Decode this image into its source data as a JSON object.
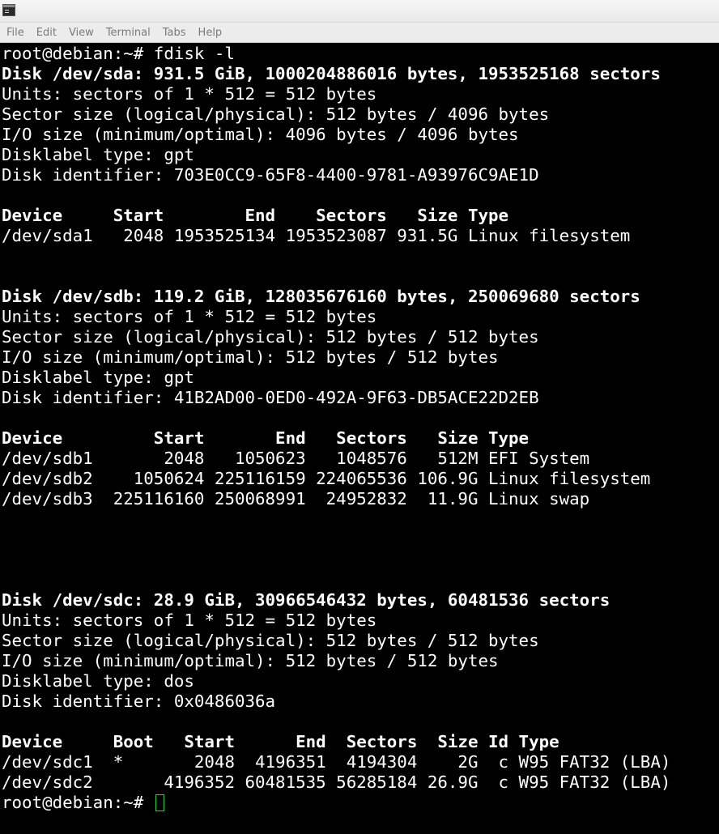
{
  "menu": {
    "items": [
      "File",
      "Edit",
      "View",
      "Terminal",
      "Tabs",
      "Help"
    ]
  },
  "terminal": {
    "lines": [
      {
        "text": "root@debian:~# fdisk -l",
        "bold": false
      },
      {
        "text": "Disk /dev/sda: 931.5 GiB, 1000204886016 bytes, 1953525168 sectors",
        "bold": true
      },
      {
        "text": "Units: sectors of 1 * 512 = 512 bytes",
        "bold": false
      },
      {
        "text": "Sector size (logical/physical): 512 bytes / 4096 bytes",
        "bold": false
      },
      {
        "text": "I/O size (minimum/optimal): 4096 bytes / 4096 bytes",
        "bold": false
      },
      {
        "text": "Disklabel type: gpt",
        "bold": false
      },
      {
        "text": "Disk identifier: 703E0CC9-65F8-4400-9781-A93976C9AE1D",
        "bold": false
      },
      {
        "text": "",
        "bold": false
      },
      {
        "text": "Device     Start        End    Sectors   Size Type",
        "bold": true
      },
      {
        "text": "/dev/sda1   2048 1953525134 1953523087 931.5G Linux filesystem",
        "bold": false
      },
      {
        "text": "",
        "bold": false
      },
      {
        "text": "",
        "bold": false
      },
      {
        "text": "Disk /dev/sdb: 119.2 GiB, 128035676160 bytes, 250069680 sectors",
        "bold": true
      },
      {
        "text": "Units: sectors of 1 * 512 = 512 bytes",
        "bold": false
      },
      {
        "text": "Sector size (logical/physical): 512 bytes / 512 bytes",
        "bold": false
      },
      {
        "text": "I/O size (minimum/optimal): 512 bytes / 512 bytes",
        "bold": false
      },
      {
        "text": "Disklabel type: gpt",
        "bold": false
      },
      {
        "text": "Disk identifier: 41B2AD00-0ED0-492A-9F63-DB5ACE22D2EB",
        "bold": false
      },
      {
        "text": "",
        "bold": false
      },
      {
        "text": "Device         Start       End   Sectors   Size Type",
        "bold": true
      },
      {
        "text": "/dev/sdb1       2048   1050623   1048576   512M EFI System",
        "bold": false
      },
      {
        "text": "/dev/sdb2    1050624 225116159 224065536 106.9G Linux filesystem",
        "bold": false
      },
      {
        "text": "/dev/sdb3  225116160 250068991  24952832  11.9G Linux swap",
        "bold": false
      },
      {
        "text": "",
        "bold": false
      },
      {
        "text": "",
        "bold": false
      },
      {
        "text": "",
        "bold": false
      },
      {
        "text": "",
        "bold": false
      },
      {
        "text": "Disk /dev/sdc: 28.9 GiB, 30966546432 bytes, 60481536 sectors",
        "bold": true
      },
      {
        "text": "Units: sectors of 1 * 512 = 512 bytes",
        "bold": false
      },
      {
        "text": "Sector size (logical/physical): 512 bytes / 512 bytes",
        "bold": false
      },
      {
        "text": "I/O size (minimum/optimal): 512 bytes / 512 bytes",
        "bold": false
      },
      {
        "text": "Disklabel type: dos",
        "bold": false
      },
      {
        "text": "Disk identifier: 0x0486036a",
        "bold": false
      },
      {
        "text": "",
        "bold": false
      },
      {
        "text": "Device     Boot   Start      End  Sectors  Size Id Type",
        "bold": true
      },
      {
        "text": "/dev/sdc1  *       2048  4196351  4194304    2G  c W95 FAT32 (LBA)",
        "bold": false
      },
      {
        "text": "/dev/sdc2       4196352 60481535 56285184 26.9G  c W95 FAT32 (LBA)",
        "bold": false
      }
    ],
    "prompt": "root@debian:~# ",
    "cursor_color": "#2ecc40"
  }
}
